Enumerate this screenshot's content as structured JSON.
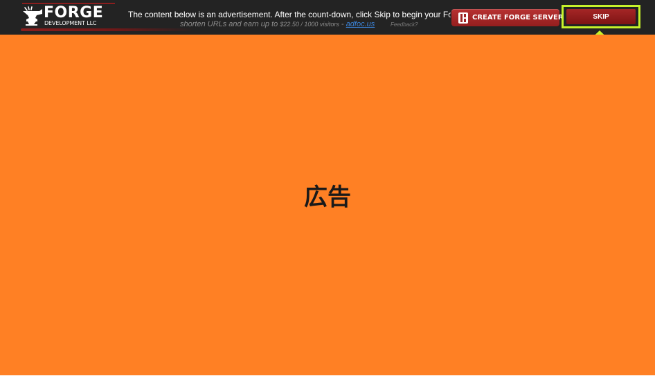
{
  "header": {
    "logo": {
      "name": "FORGE",
      "sub": "DEVELOPMENT LLC",
      "icon": "anvil-icon"
    },
    "notice": "The content below is an advertisement. After the count-down, click Skip to begin your Forge d",
    "promo": {
      "text": "shorten URLs and earn up to",
      "rate": "$22.50 / 1000 visitors",
      "separator": "-",
      "link": "adfoc.us"
    },
    "feedback": "Feedback?",
    "create_button": {
      "label": "CREATE FORGE SERVER",
      "icon": "server-icon"
    },
    "skip_button": {
      "label": "SKIP",
      "highlight_color": "#c6f22a"
    },
    "skip_arrow_icon": "up-arrow-icon"
  },
  "advertisement": {
    "text": "広告",
    "background_color": "#ff8024"
  },
  "colors": {
    "topbar": "#232323",
    "brand_red": "#951e1e",
    "highlight": "#c6f22a",
    "link": "#3b82d6"
  }
}
